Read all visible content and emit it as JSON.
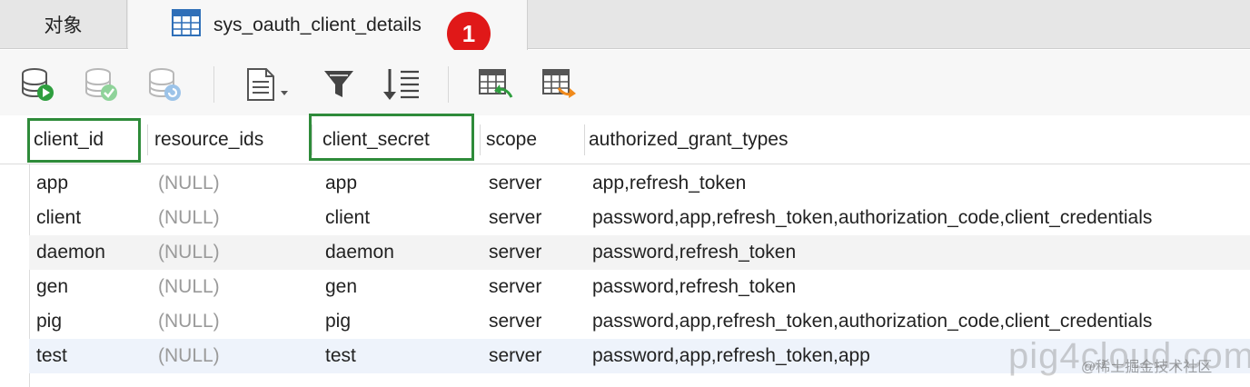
{
  "tabs": {
    "objects_label": "对象",
    "active_label": "sys_oauth_client_details",
    "badge": "1"
  },
  "columns": [
    "client_id",
    "resource_ids",
    "client_secret",
    "scope",
    "authorized_grant_types"
  ],
  "rows": [
    [
      "app",
      "(NULL)",
      "app",
      "server",
      "app,refresh_token"
    ],
    [
      "client",
      "(NULL)",
      "client",
      "server",
      "password,app,refresh_token,authorization_code,client_credentials"
    ],
    [
      "daemon",
      "(NULL)",
      "daemon",
      "server",
      "password,refresh_token"
    ],
    [
      "gen",
      "(NULL)",
      "gen",
      "server",
      "password,refresh_token"
    ],
    [
      "pig",
      "(NULL)",
      "pig",
      "server",
      "password,app,refresh_token,authorization_code,client_credentials"
    ],
    [
      "test",
      "(NULL)",
      "test",
      "server",
      "password,app,refresh_token,app"
    ]
  ],
  "toolbar_icons": [
    "add-record-icon",
    "apply-changes-icon",
    "discard-changes-icon",
    "text-view-icon",
    "filter-icon",
    "sort-icon",
    "import-icon",
    "export-icon"
  ],
  "watermark": {
    "text": "pig4cloud.com",
    "subtext": "@稀土掘金技术社区"
  },
  "colors": {
    "highlight": "#2e8b3a",
    "badge": "#e01818"
  }
}
